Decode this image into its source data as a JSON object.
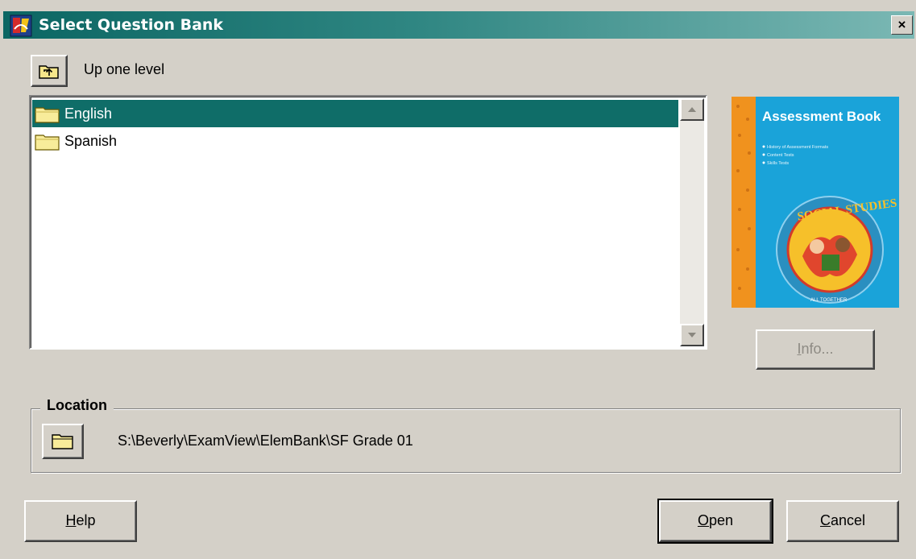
{
  "window": {
    "title": "Select Question Bank",
    "close_label": "×"
  },
  "nav": {
    "up_label": "Up one level",
    "up_icon": "folder-up-icon"
  },
  "list": {
    "items": [
      {
        "label": "English",
        "icon": "folder-icon",
        "selected": true
      },
      {
        "label": "Spanish",
        "icon": "folder-icon",
        "selected": false
      }
    ]
  },
  "cover": {
    "title": "Assessment Book",
    "bullets": [
      "History of Assessment Formats",
      "Content Tests",
      "Skills Tests"
    ],
    "seal_text": "SOCIAL STUDIES",
    "seal_bottom": "ALL TOGETHER"
  },
  "info_button": {
    "label": "Info...",
    "accel": "I",
    "rest": "nfo...",
    "enabled": false
  },
  "location": {
    "group_label": "Location",
    "path": "S:\\Beverly\\ExamView\\ElemBank\\SF Grade 01"
  },
  "buttons": {
    "help": {
      "accel": "H",
      "rest": "elp"
    },
    "open": {
      "accel": "O",
      "rest": "pen"
    },
    "cancel": {
      "accel": "C",
      "rest": "ancel"
    }
  },
  "colors": {
    "title_gradient_start": "#0b6663",
    "title_gradient_end": "#7bb8b4",
    "selection": "#0f6d68",
    "face": "#d4d0c8",
    "cover_blue": "#1aa3d9",
    "cover_orange": "#f0921e"
  }
}
